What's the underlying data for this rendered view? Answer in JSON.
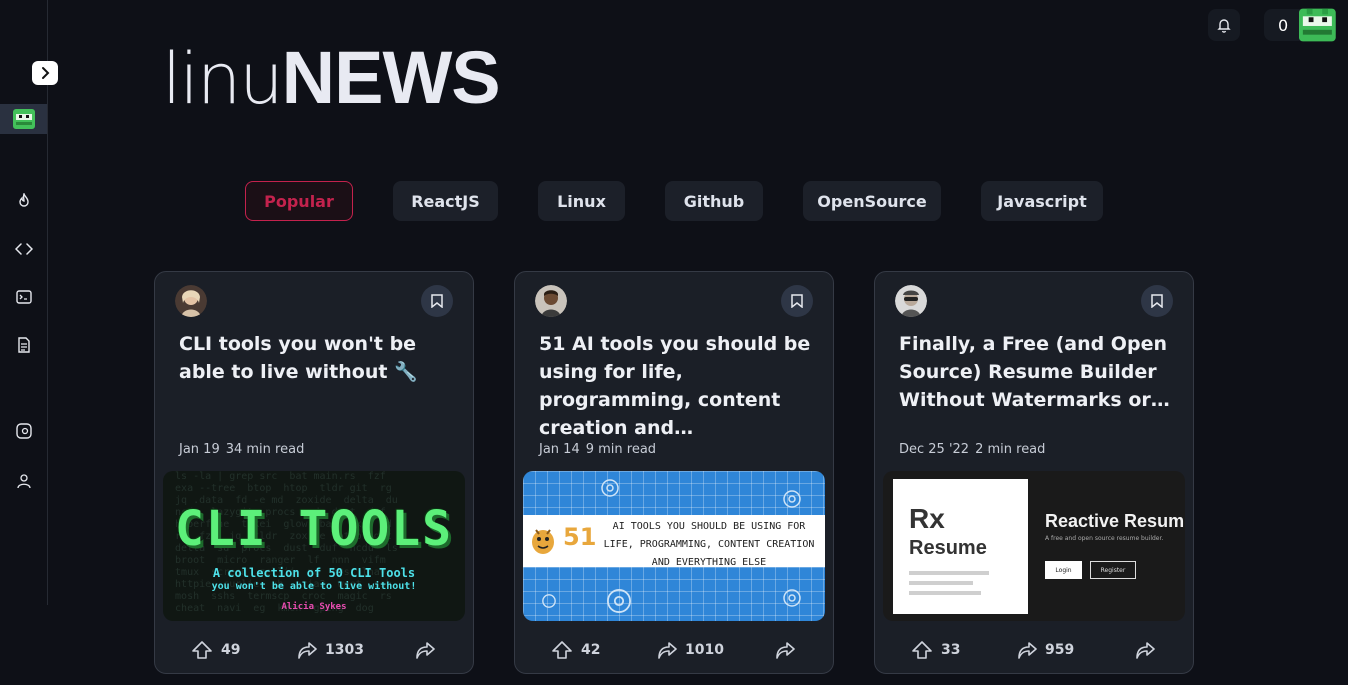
{
  "app": {
    "logo_thin": "linu",
    "logo_bold": "NEWS"
  },
  "topbar": {
    "reputation_count": "0",
    "bell_icon": "bell-icon"
  },
  "sidebar": {
    "items": [
      "flame-icon",
      "code-icon",
      "terminal-icon",
      "document-icon",
      "discord-icon",
      "users-icon"
    ]
  },
  "tabs": [
    {
      "label": "Popular",
      "active": true
    },
    {
      "label": "ReactJS"
    },
    {
      "label": "Linux"
    },
    {
      "label": "Github"
    },
    {
      "label": "OpenSource"
    },
    {
      "label": "Javascript"
    }
  ],
  "cards": [
    {
      "title": "CLI tools you won't be able to live without 🔧",
      "date": "Jan 19",
      "read_time": "34 min read",
      "upvotes": "49",
      "comments": "1303",
      "thumb": {
        "heading": "CLI TOOLS",
        "line1": "A collection of 50 CLI Tools",
        "line2": "you won't be able to live without!",
        "author": "Alicia Sykes"
      }
    },
    {
      "title": "51 AI tools you should be using for life, programming, content creation and…",
      "date": "Jan 14",
      "read_time": "9 min read",
      "upvotes": "42",
      "comments": "1010",
      "thumb": {
        "number": "51",
        "line1": "AI TOOLS YOU SHOULD BE USING FOR",
        "line2": "LIFE, PROGRAMMING, CONTENT CREATION",
        "line3": "AND EVERYTHING ELSE"
      }
    },
    {
      "title": "Finally, a Free (and Open Source) Resume Builder Without Watermarks or…",
      "date": "Dec 25 '22",
      "read_time": "2 min read",
      "upvotes": "33",
      "comments": "959",
      "thumb": {
        "logo_rx": "Rx",
        "logo_word": "Resume",
        "heading": "Reactive Resum",
        "sub": "A free and open source resume builder.",
        "login": "Login",
        "register": "Register"
      }
    }
  ]
}
